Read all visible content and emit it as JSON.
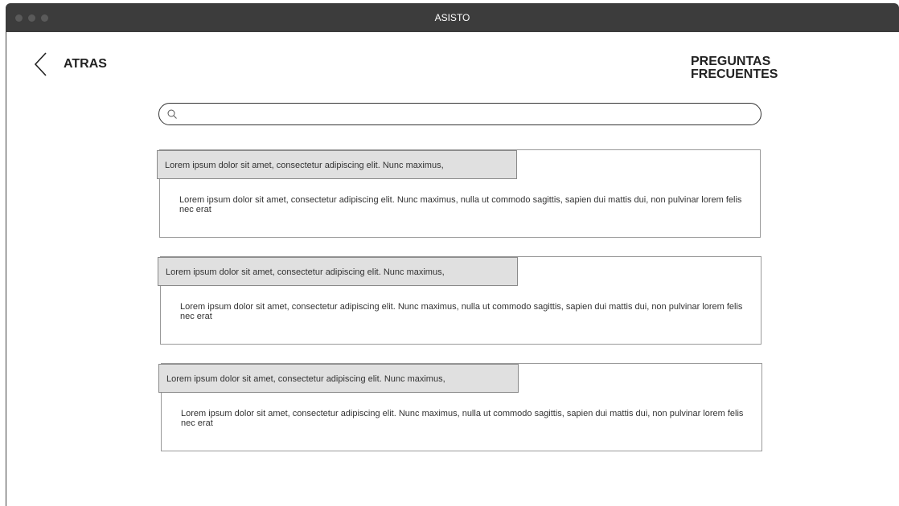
{
  "window": {
    "title": "ASISTO"
  },
  "nav": {
    "back_label": "ATRAS"
  },
  "page": {
    "title": "PREGUNTAS FRECUENTES"
  },
  "search": {
    "placeholder": "",
    "value": ""
  },
  "faqs": [
    {
      "question": "Lorem ipsum dolor sit amet, consectetur adipiscing elit. Nunc maximus,",
      "answer": "Lorem ipsum dolor sit amet, consectetur adipiscing elit. Nunc maximus, nulla ut commodo sagittis, sapien dui mattis dui, non pulvinar lorem felis nec erat"
    },
    {
      "question": "Lorem ipsum dolor sit amet, consectetur adipiscing elit. Nunc maximus,",
      "answer": "Lorem ipsum dolor sit amet, consectetur adipiscing elit. Nunc maximus, nulla ut commodo sagittis, sapien dui mattis dui, non pulvinar lorem felis nec erat"
    },
    {
      "question": "Lorem ipsum dolor sit amet, consectetur adipiscing elit. Nunc maximus,",
      "answer": "Lorem ipsum dolor sit amet, consectetur adipiscing elit. Nunc maximus, nulla ut commodo sagittis, sapien dui mattis dui, non pulvinar lorem felis nec erat"
    }
  ],
  "icons": {
    "back": "chevron-left-icon",
    "search": "search-icon",
    "window_controls": [
      "close-dot",
      "minimize-dot",
      "maximize-dot"
    ]
  },
  "colors": {
    "titlebar": "#3c3c3c",
    "question_bg": "#e0e0e0",
    "border": "#999999"
  }
}
